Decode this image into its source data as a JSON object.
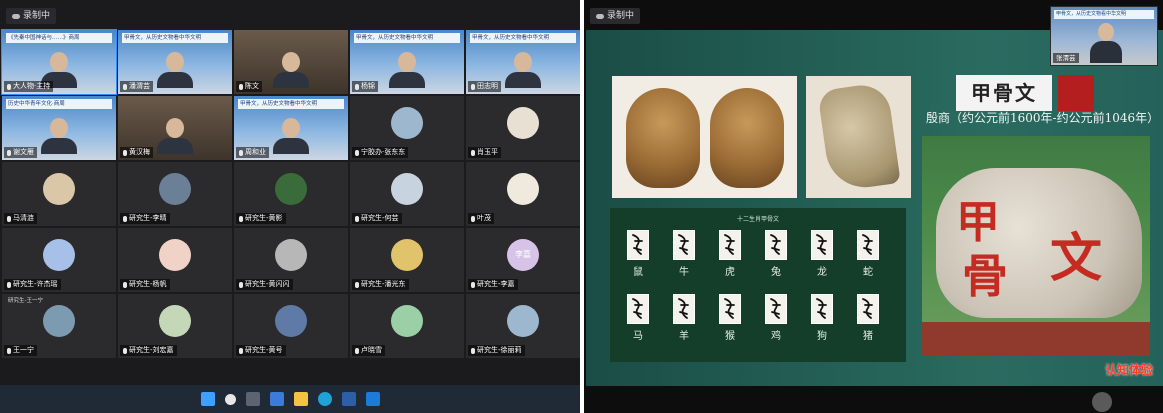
{
  "left": {
    "recording_label": "录制中",
    "video_tiles": [
      {
        "banner": "《先秦中国神话与……》商周",
        "name": "大人物·主持"
      },
      {
        "banner": "甲骨文，从历史文物看中华文明",
        "name": "潘渭芸"
      },
      {
        "banner": "",
        "name": "陈文"
      },
      {
        "banner": "甲骨文，从历史文物看中华文明",
        "name": "杨锦"
      },
      {
        "banner": "甲骨文，从历史文物看中华文明",
        "name": "田志明"
      },
      {
        "banner": "历史中华青年文化·商周",
        "name": "谢文雁"
      },
      {
        "banner": "",
        "name": "黄汉梅"
      },
      {
        "banner": "甲骨文，从历史文物看中华文明",
        "name": "周和业"
      }
    ],
    "avatar_tiles": [
      {
        "name": "宁胶办·张东东"
      },
      {
        "name": "肖玉平"
      },
      {
        "name": "马清涟"
      },
      {
        "name": "研究生-李晴"
      },
      {
        "name": "研究生-黄影"
      },
      {
        "name": "研究生-何芸"
      },
      {
        "name": "叶茂"
      },
      {
        "name": "研究生-许杰瑶"
      },
      {
        "name": "研究生-杨帆"
      },
      {
        "name": "研究生-黄闪闪"
      },
      {
        "name": "研究生-潘光东"
      },
      {
        "name": "研究生-李嘉"
      },
      {
        "name": "王一宁"
      },
      {
        "name": "研究生-刘宏嘉"
      },
      {
        "name": "研究生-黄号"
      },
      {
        "name": "卢晓雪"
      },
      {
        "name": "研究生-徐丽莉"
      }
    ],
    "blue_avatar_label": "李嘉",
    "small_label": "研究生-王一宁"
  },
  "right": {
    "recording_label": "录制中",
    "pip_banner": "甲骨文，从历史文物看中华文明",
    "pip_name": "张渭芸",
    "slide": {
      "title": "甲骨文",
      "subtitle": "殷商（约公元前1600年-约公元前1046年）",
      "zodiac_heading": "十二生肖甲骨文",
      "zodiac_labels": [
        "鼠",
        "牛",
        "虎",
        "兔",
        "龙",
        "蛇",
        "马",
        "羊",
        "猴",
        "鸡",
        "狗",
        "猪"
      ],
      "stone_chars": [
        "甲",
        "骨",
        "文"
      ],
      "watermark": "认知体验"
    }
  },
  "colors": {
    "slide_green": "#1f5c52",
    "title_red": "#b51e1e",
    "speaking_outline": "#2f8cff"
  }
}
